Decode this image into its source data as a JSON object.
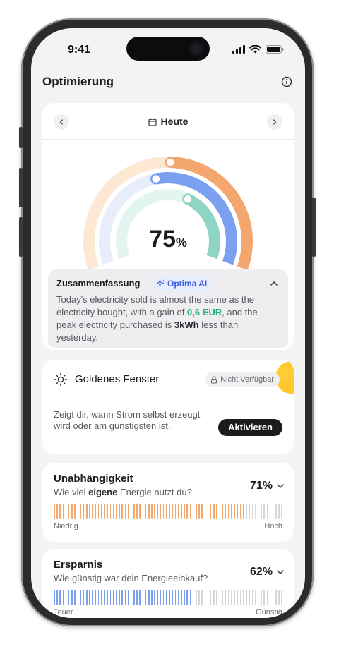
{
  "status": {
    "time": "9:41"
  },
  "header": {
    "title": "Optimierung",
    "info_icon": "info-icon"
  },
  "date_nav": {
    "label": "Heute",
    "prev_icon": "chevron-left-icon",
    "next_icon": "chevron-right-icon"
  },
  "gauge": {
    "value": "75",
    "unit": "%",
    "rings": [
      {
        "ring": "outer",
        "color": "#f3a66e",
        "track": "#fde8d4",
        "fraction": 0.62
      },
      {
        "ring": "middle",
        "color": "#7aa0ef",
        "track": "#e7edfb",
        "fraction": 0.55
      },
      {
        "ring": "inner",
        "color": "#8fd4c4",
        "track": "#e3f5f0",
        "fraction": 0.75
      }
    ]
  },
  "summary": {
    "title": "Zusammenfassung",
    "badge": "Optima AI",
    "text_1": "Today's electricity sold is almost the same as the electricity bought, with a gain of ",
    "gain": "0,6 EUR",
    "text_2": ", and the peak electricity purchased is ",
    "peak": "3kWh",
    "text_3": " less than yesterday."
  },
  "golden_window": {
    "title": "Goldenes Fenster",
    "badge": "Nicht Verfügbar",
    "description": "Zeigt dir, wann Strom selbst erzeugt wird oder am günstigsten ist.",
    "button": "Aktivieren"
  },
  "independence": {
    "title": "Unabhängigkeit",
    "sub_1": "Wie viel ",
    "sub_bold": "eigene",
    "sub_2": " Energie nutzt du?",
    "value": "71%",
    "level_percent": 83,
    "low_label": "Niedrig",
    "high_label": "Hoch",
    "color": "#f3a66e"
  },
  "savings": {
    "title": "Ersparnis",
    "subtitle": "Wie günstig war dein Energieeinkauf?",
    "value": "62%",
    "level_percent": 62,
    "low_label": "Teuer",
    "high_label": "Günstig",
    "color": "#7aa0ef"
  },
  "colors": {
    "accent_green": "#27b07a",
    "accent_blue": "#3d5ee0",
    "sun": "#ffc01a"
  }
}
